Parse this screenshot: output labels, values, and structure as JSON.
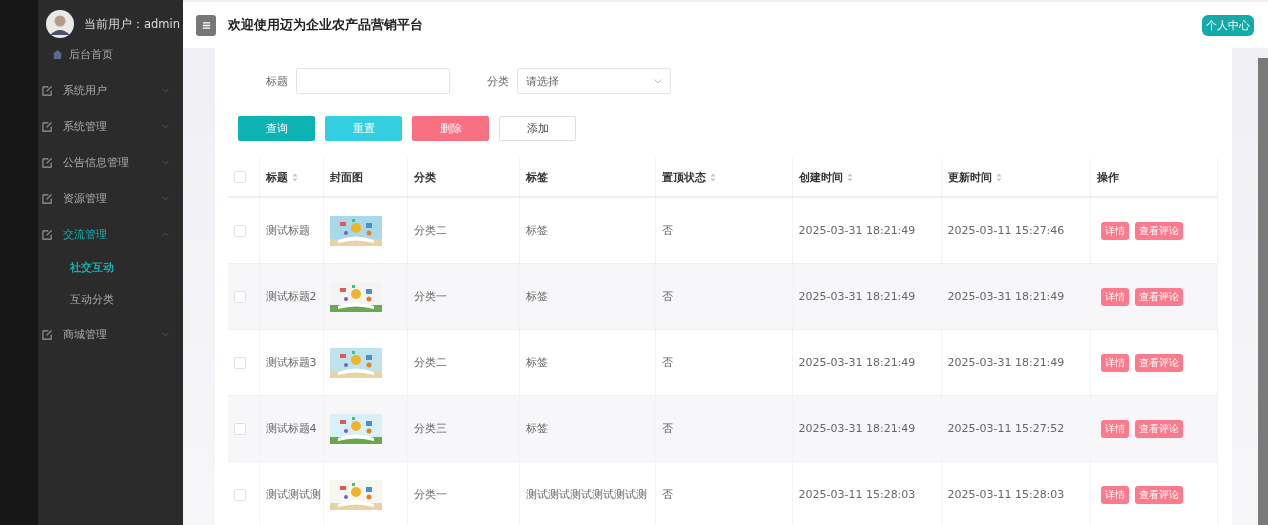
{
  "user": {
    "label": "当前用户：admin"
  },
  "sidebar": {
    "items": [
      {
        "kind": "link",
        "label": "后台首页"
      },
      {
        "kind": "menu",
        "label": "系统用户",
        "expanded": false
      },
      {
        "kind": "menu",
        "label": "系统管理",
        "expanded": false
      },
      {
        "kind": "menu",
        "label": "公告信息管理",
        "expanded": false
      },
      {
        "kind": "menu",
        "label": "资源管理",
        "expanded": false
      },
      {
        "kind": "menu",
        "label": "交流管理",
        "expanded": true,
        "children": [
          {
            "label": "社交互动",
            "selected": true
          },
          {
            "label": "互动分类",
            "selected": false
          }
        ]
      },
      {
        "kind": "menu",
        "label": "商城管理",
        "expanded": false
      }
    ]
  },
  "header": {
    "title": "欢迎使用迈为企业农产品营销平台",
    "profile_button": "个人中心"
  },
  "filters": [
    {
      "kind": "input",
      "label": "标题"
    },
    {
      "kind": "select",
      "label": "分类",
      "placeholder": "请选择"
    }
  ],
  "buttons": [
    {
      "kind": "primary",
      "label": "查询"
    },
    {
      "kind": "info",
      "label": "重置"
    },
    {
      "kind": "danger",
      "label": "删除"
    },
    {
      "kind": "plain",
      "label": "添加"
    }
  ],
  "table": {
    "header_checked": false,
    "columns": [
      {
        "label": "标题",
        "sortable": true
      },
      {
        "label": "封面图",
        "sortable": false
      },
      {
        "label": "分类",
        "sortable": false
      },
      {
        "label": "标签",
        "sortable": false
      },
      {
        "label": "置顶状态",
        "sortable": true
      },
      {
        "label": "创建时间",
        "sortable": true
      },
      {
        "label": "更新时间",
        "sortable": true
      },
      {
        "label": "操作",
        "sortable": false
      }
    ],
    "rows": [
      {
        "checked": false,
        "title": "测试标题",
        "category": "分类二",
        "tag": "标签",
        "pinned": "否",
        "created": "2025-03-31 18:21:49",
        "updated": "2025-03-11 15:27:46",
        "actions": [
          "详情",
          "查看评论"
        ]
      },
      {
        "checked": false,
        "title": "测试标题2",
        "category": "分类一",
        "tag": "标签",
        "pinned": "否",
        "created": "2025-03-31 18:21:49",
        "updated": "2025-03-31 18:21:49",
        "actions": [
          "详情",
          "查看评论"
        ]
      },
      {
        "checked": false,
        "title": "测试标题3",
        "category": "分类二",
        "tag": "标签",
        "pinned": "否",
        "created": "2025-03-31 18:21:49",
        "updated": "2025-03-31 18:21:49",
        "actions": [
          "详情",
          "查看评论"
        ]
      },
      {
        "checked": false,
        "title": "测试标题4",
        "category": "分类三",
        "tag": "标签",
        "pinned": "否",
        "created": "2025-03-31 18:21:49",
        "updated": "2025-03-11 15:27:52",
        "actions": [
          "详情",
          "查看评论"
        ]
      },
      {
        "checked": false,
        "title": "测试测试测",
        "category": "分类一",
        "tag": "测试测试测试测试测试测",
        "pinned": "否",
        "created": "2025-03-11 15:28:03",
        "updated": "2025-03-11 15:28:03",
        "actions": [
          "详情",
          "查看评论"
        ]
      }
    ]
  }
}
